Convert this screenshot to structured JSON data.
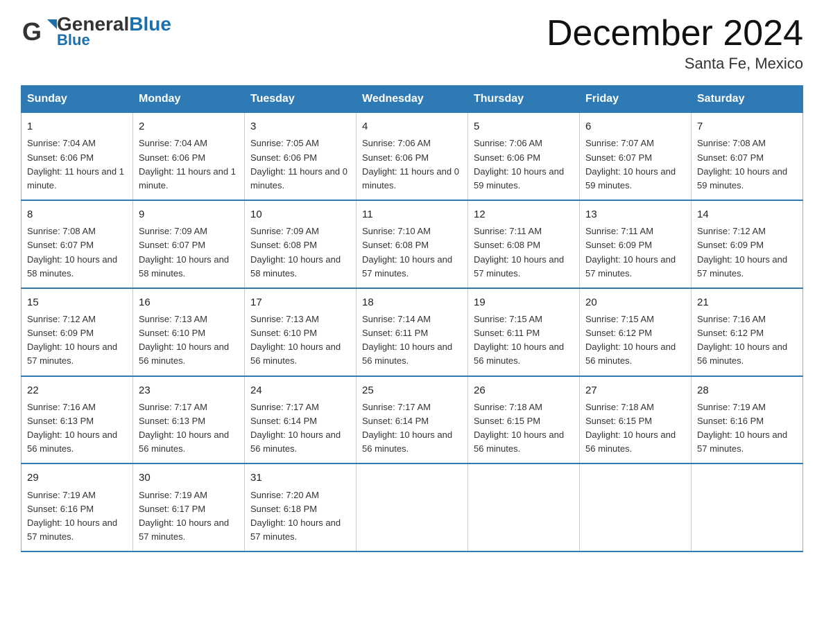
{
  "header": {
    "logo_general": "General",
    "logo_blue": "Blue",
    "month_year": "December 2024",
    "location": "Santa Fe, Mexico"
  },
  "days_of_week": [
    "Sunday",
    "Monday",
    "Tuesday",
    "Wednesday",
    "Thursday",
    "Friday",
    "Saturday"
  ],
  "weeks": [
    [
      {
        "day": "1",
        "sunrise": "7:04 AM",
        "sunset": "6:06 PM",
        "daylight": "11 hours and 1 minute."
      },
      {
        "day": "2",
        "sunrise": "7:04 AM",
        "sunset": "6:06 PM",
        "daylight": "11 hours and 1 minute."
      },
      {
        "day": "3",
        "sunrise": "7:05 AM",
        "sunset": "6:06 PM",
        "daylight": "11 hours and 0 minutes."
      },
      {
        "day": "4",
        "sunrise": "7:06 AM",
        "sunset": "6:06 PM",
        "daylight": "11 hours and 0 minutes."
      },
      {
        "day": "5",
        "sunrise": "7:06 AM",
        "sunset": "6:06 PM",
        "daylight": "10 hours and 59 minutes."
      },
      {
        "day": "6",
        "sunrise": "7:07 AM",
        "sunset": "6:07 PM",
        "daylight": "10 hours and 59 minutes."
      },
      {
        "day": "7",
        "sunrise": "7:08 AM",
        "sunset": "6:07 PM",
        "daylight": "10 hours and 59 minutes."
      }
    ],
    [
      {
        "day": "8",
        "sunrise": "7:08 AM",
        "sunset": "6:07 PM",
        "daylight": "10 hours and 58 minutes."
      },
      {
        "day": "9",
        "sunrise": "7:09 AM",
        "sunset": "6:07 PM",
        "daylight": "10 hours and 58 minutes."
      },
      {
        "day": "10",
        "sunrise": "7:09 AM",
        "sunset": "6:08 PM",
        "daylight": "10 hours and 58 minutes."
      },
      {
        "day": "11",
        "sunrise": "7:10 AM",
        "sunset": "6:08 PM",
        "daylight": "10 hours and 57 minutes."
      },
      {
        "day": "12",
        "sunrise": "7:11 AM",
        "sunset": "6:08 PM",
        "daylight": "10 hours and 57 minutes."
      },
      {
        "day": "13",
        "sunrise": "7:11 AM",
        "sunset": "6:09 PM",
        "daylight": "10 hours and 57 minutes."
      },
      {
        "day": "14",
        "sunrise": "7:12 AM",
        "sunset": "6:09 PM",
        "daylight": "10 hours and 57 minutes."
      }
    ],
    [
      {
        "day": "15",
        "sunrise": "7:12 AM",
        "sunset": "6:09 PM",
        "daylight": "10 hours and 57 minutes."
      },
      {
        "day": "16",
        "sunrise": "7:13 AM",
        "sunset": "6:10 PM",
        "daylight": "10 hours and 56 minutes."
      },
      {
        "day": "17",
        "sunrise": "7:13 AM",
        "sunset": "6:10 PM",
        "daylight": "10 hours and 56 minutes."
      },
      {
        "day": "18",
        "sunrise": "7:14 AM",
        "sunset": "6:11 PM",
        "daylight": "10 hours and 56 minutes."
      },
      {
        "day": "19",
        "sunrise": "7:15 AM",
        "sunset": "6:11 PM",
        "daylight": "10 hours and 56 minutes."
      },
      {
        "day": "20",
        "sunrise": "7:15 AM",
        "sunset": "6:12 PM",
        "daylight": "10 hours and 56 minutes."
      },
      {
        "day": "21",
        "sunrise": "7:16 AM",
        "sunset": "6:12 PM",
        "daylight": "10 hours and 56 minutes."
      }
    ],
    [
      {
        "day": "22",
        "sunrise": "7:16 AM",
        "sunset": "6:13 PM",
        "daylight": "10 hours and 56 minutes."
      },
      {
        "day": "23",
        "sunrise": "7:17 AM",
        "sunset": "6:13 PM",
        "daylight": "10 hours and 56 minutes."
      },
      {
        "day": "24",
        "sunrise": "7:17 AM",
        "sunset": "6:14 PM",
        "daylight": "10 hours and 56 minutes."
      },
      {
        "day": "25",
        "sunrise": "7:17 AM",
        "sunset": "6:14 PM",
        "daylight": "10 hours and 56 minutes."
      },
      {
        "day": "26",
        "sunrise": "7:18 AM",
        "sunset": "6:15 PM",
        "daylight": "10 hours and 56 minutes."
      },
      {
        "day": "27",
        "sunrise": "7:18 AM",
        "sunset": "6:15 PM",
        "daylight": "10 hours and 56 minutes."
      },
      {
        "day": "28",
        "sunrise": "7:19 AM",
        "sunset": "6:16 PM",
        "daylight": "10 hours and 57 minutes."
      }
    ],
    [
      {
        "day": "29",
        "sunrise": "7:19 AM",
        "sunset": "6:16 PM",
        "daylight": "10 hours and 57 minutes."
      },
      {
        "day": "30",
        "sunrise": "7:19 AM",
        "sunset": "6:17 PM",
        "daylight": "10 hours and 57 minutes."
      },
      {
        "day": "31",
        "sunrise": "7:20 AM",
        "sunset": "6:18 PM",
        "daylight": "10 hours and 57 minutes."
      },
      null,
      null,
      null,
      null
    ]
  ],
  "labels": {
    "sunrise": "Sunrise:",
    "sunset": "Sunset:",
    "daylight": "Daylight:"
  }
}
